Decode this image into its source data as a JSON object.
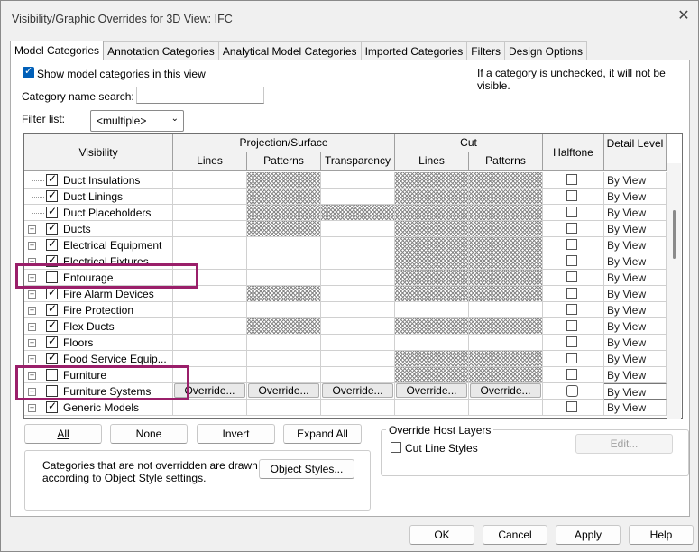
{
  "window": {
    "title": "Visibility/Graphic Overrides for 3D View: IFC",
    "close_glyph": "✕"
  },
  "tabs": [
    {
      "label": "Model Categories",
      "active": true
    },
    {
      "label": "Annotation Categories",
      "active": false
    },
    {
      "label": "Analytical Model Categories",
      "active": false
    },
    {
      "label": "Imported Categories",
      "active": false
    },
    {
      "label": "Filters",
      "active": false
    },
    {
      "label": "Design Options",
      "active": false
    }
  ],
  "options": {
    "show_model_categories_label": "Show model categories in this view",
    "show_model_categories_checked": true,
    "unchecked_note": "If a category is unchecked, it will not be visible.",
    "category_search_label": "Category name search:",
    "category_search_value": "",
    "filter_list_label": "Filter list:",
    "filter_list_value": "<multiple>"
  },
  "grid": {
    "headers": {
      "visibility": "Visibility",
      "projection_surface": "Projection/Surface",
      "cut": "Cut",
      "halftone": "Halftone",
      "detail_level": "Detail Level",
      "lines": "Lines",
      "patterns": "Patterns",
      "transparency": "Transparency",
      "cut_lines": "Lines",
      "cut_patterns": "Patterns"
    },
    "override_label": "Override...",
    "rows": [
      {
        "name": "Duct Insulations",
        "checked": true,
        "expand": false,
        "detail": "By View",
        "hatch": [
          false,
          true,
          false,
          true,
          true
        ]
      },
      {
        "name": "Duct Linings",
        "checked": true,
        "expand": false,
        "detail": "By View",
        "hatch": [
          false,
          true,
          false,
          true,
          true
        ]
      },
      {
        "name": "Duct Placeholders",
        "checked": true,
        "expand": false,
        "detail": "By View",
        "hatch": [
          false,
          true,
          true,
          true,
          true
        ]
      },
      {
        "name": "Ducts",
        "checked": true,
        "expand": true,
        "detail": "By View",
        "hatch": [
          false,
          true,
          false,
          true,
          true
        ]
      },
      {
        "name": "Electrical Equipment",
        "checked": true,
        "expand": true,
        "detail": "By View",
        "hatch": [
          false,
          false,
          false,
          true,
          true
        ]
      },
      {
        "name": "Electrical Fixtures",
        "checked": true,
        "expand": true,
        "detail": "By View",
        "hatch": [
          false,
          false,
          false,
          true,
          true
        ]
      },
      {
        "name": "Entourage",
        "checked": false,
        "expand": true,
        "detail": "By View",
        "hatch": [
          false,
          false,
          false,
          true,
          true
        ]
      },
      {
        "name": "Fire Alarm Devices",
        "checked": true,
        "expand": true,
        "detail": "By View",
        "hatch": [
          false,
          true,
          false,
          true,
          true
        ]
      },
      {
        "name": "Fire Protection",
        "checked": true,
        "expand": true,
        "detail": "By View",
        "hatch": [
          false,
          false,
          false,
          false,
          false
        ]
      },
      {
        "name": "Flex Ducts",
        "checked": true,
        "expand": true,
        "detail": "By View",
        "hatch": [
          false,
          true,
          false,
          true,
          true
        ]
      },
      {
        "name": "Floors",
        "checked": true,
        "expand": true,
        "detail": "By View",
        "hatch": [
          false,
          false,
          false,
          false,
          false
        ]
      },
      {
        "name": "Food Service Equip...",
        "checked": true,
        "expand": true,
        "detail": "By View",
        "hatch": [
          false,
          false,
          false,
          true,
          true
        ]
      },
      {
        "name": "Furniture",
        "checked": false,
        "expand": true,
        "detail": "By View",
        "hatch": [
          false,
          false,
          false,
          true,
          true
        ]
      },
      {
        "name": "Furniture Systems",
        "checked": false,
        "expand": true,
        "detail": "By View",
        "hatch": [
          false,
          false,
          false,
          false,
          false
        ],
        "selected": true
      },
      {
        "name": "Generic Models",
        "checked": true,
        "expand": true,
        "detail": "By View",
        "hatch": [
          false,
          false,
          false,
          false,
          false
        ]
      }
    ]
  },
  "buttons": {
    "all": "All",
    "none": "None",
    "invert": "Invert",
    "expand_all": "Expand All",
    "object_styles": "Object Styles...",
    "edit": "Edit...",
    "ok": "OK",
    "cancel": "Cancel",
    "apply": "Apply",
    "help": "Help"
  },
  "override_host_layers": {
    "title": "Override Host Layers",
    "cut_line_styles_label": "Cut Line Styles",
    "cut_line_styles_checked": false
  },
  "info_text": "Categories that are not overridden are drawn according to Object Style settings."
}
